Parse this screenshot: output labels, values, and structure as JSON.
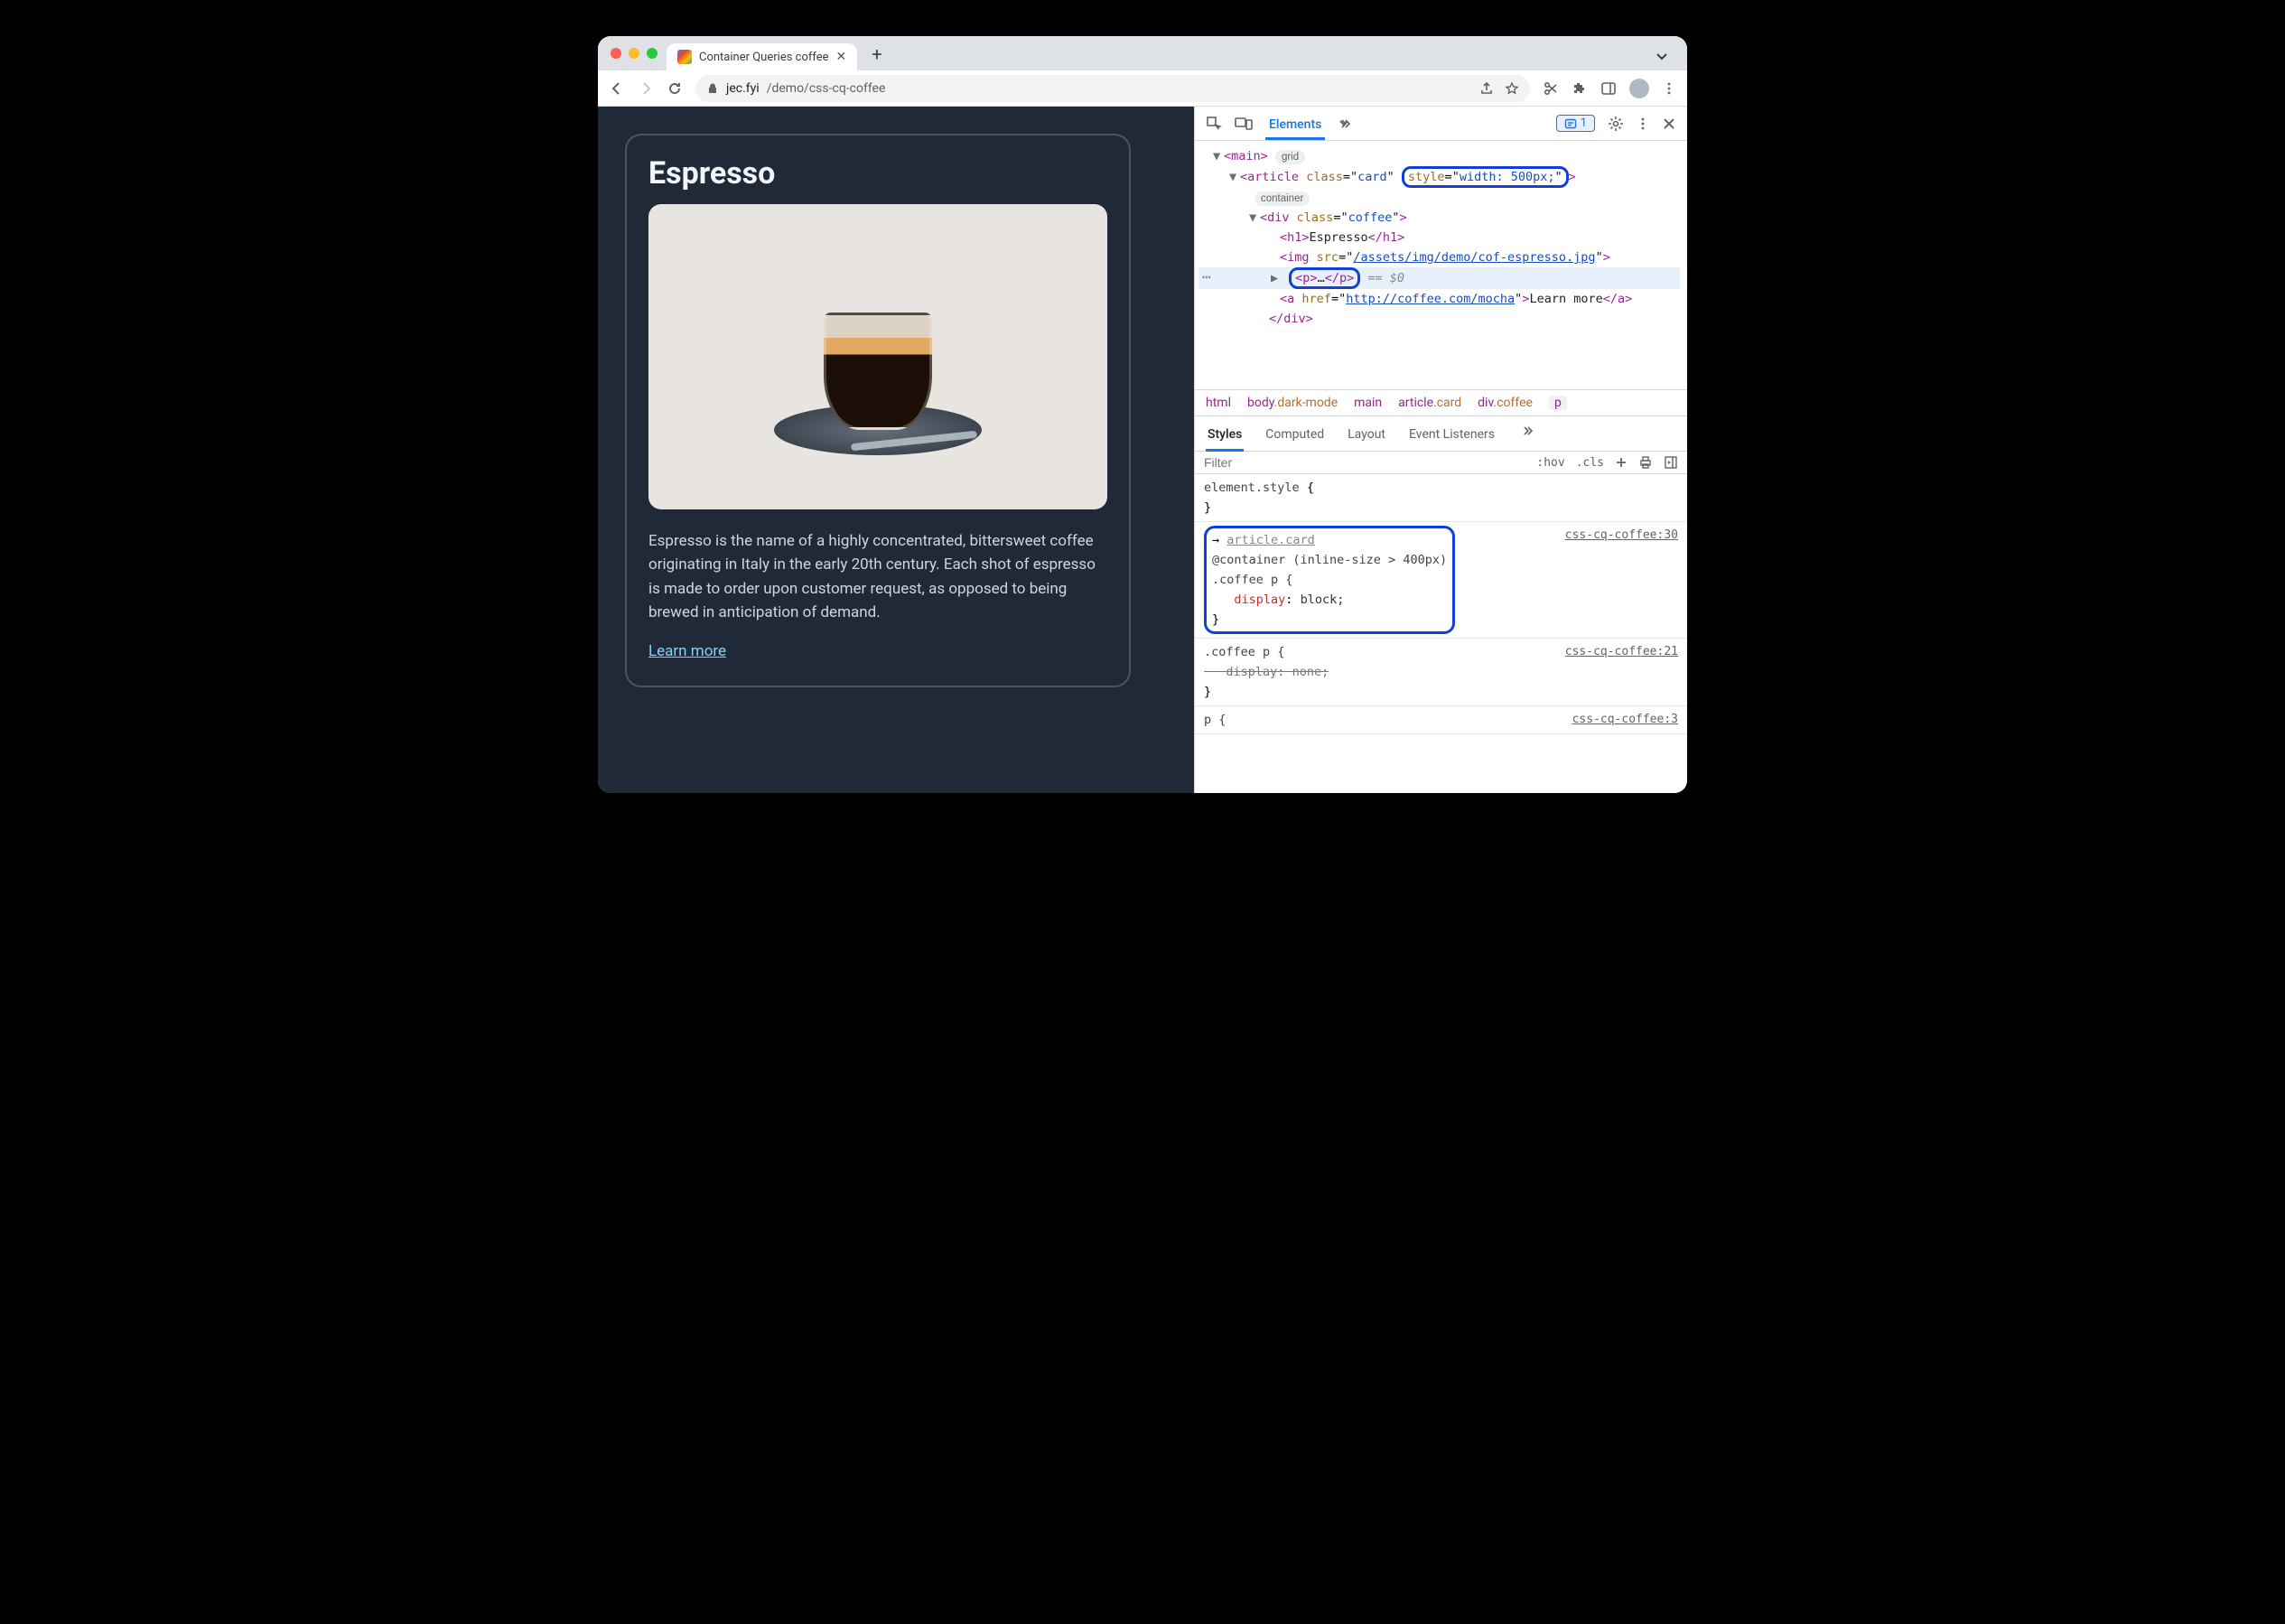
{
  "tab": {
    "title": "Container Queries coffee"
  },
  "url": {
    "host": "jec.fyi",
    "path": "/demo/css-cq-coffee"
  },
  "devtools": {
    "topTab": "Elements",
    "issuesCount": "1",
    "breadcrumb": [
      "html",
      "body.dark-mode",
      "main",
      "article.card",
      "div.coffee",
      "p"
    ],
    "stylesTabs": [
      "Styles",
      "Computed",
      "Layout",
      "Event Listeners"
    ],
    "filterPlaceholder": "Filter",
    "hov": ":hov",
    "cls": ".cls"
  },
  "dom": {
    "main": "main",
    "mainBadge": "grid",
    "article": {
      "tag": "article",
      "classAttr": "class",
      "classVal": "card",
      "styleAttr": "style",
      "styleVal": "width: 500px;",
      "badge": "container"
    },
    "div": {
      "tag": "div",
      "classAttr": "class",
      "classVal": "coffee"
    },
    "h1": {
      "open": "h1",
      "text": "Espresso",
      "close": "h1"
    },
    "img": {
      "tag": "img",
      "srcAttr": "src",
      "srcVal": "/assets/img/demo/cof-espresso.jpg"
    },
    "p": {
      "tag": "p",
      "ell": "…",
      "close": "p",
      "eq": "== $0"
    },
    "a": {
      "tag": "a",
      "hrefAttr": "href",
      "hrefVal": "http://coffee.com/mocha",
      "text": "Learn more",
      "close": "a"
    },
    "divClose": "div"
  },
  "rules": {
    "r0": {
      "sel": "element.style",
      "open": "{",
      "close": "}"
    },
    "r1": {
      "inherit": "article.card",
      "cq": "@container (inline-size > 400px)",
      "sel": ".coffee p {",
      "prop": "display",
      "val": "block;",
      "close": "}",
      "src": "css-cq-coffee:30"
    },
    "r2": {
      "sel": ".coffee p {",
      "prop": "display",
      "val": "none;",
      "close": "}",
      "src": "css-cq-coffee:21"
    },
    "r3": {
      "sel": "p {",
      "src": "css-cq-coffee:3"
    }
  },
  "card": {
    "title": "Espresso",
    "desc": "Espresso is the name of a highly concentrated, bittersweet coffee originating in Italy in the early 20th century. Each shot of espresso is made to order upon customer request, as opposed to being brewed in anticipation of demand.",
    "link": "Learn more"
  }
}
